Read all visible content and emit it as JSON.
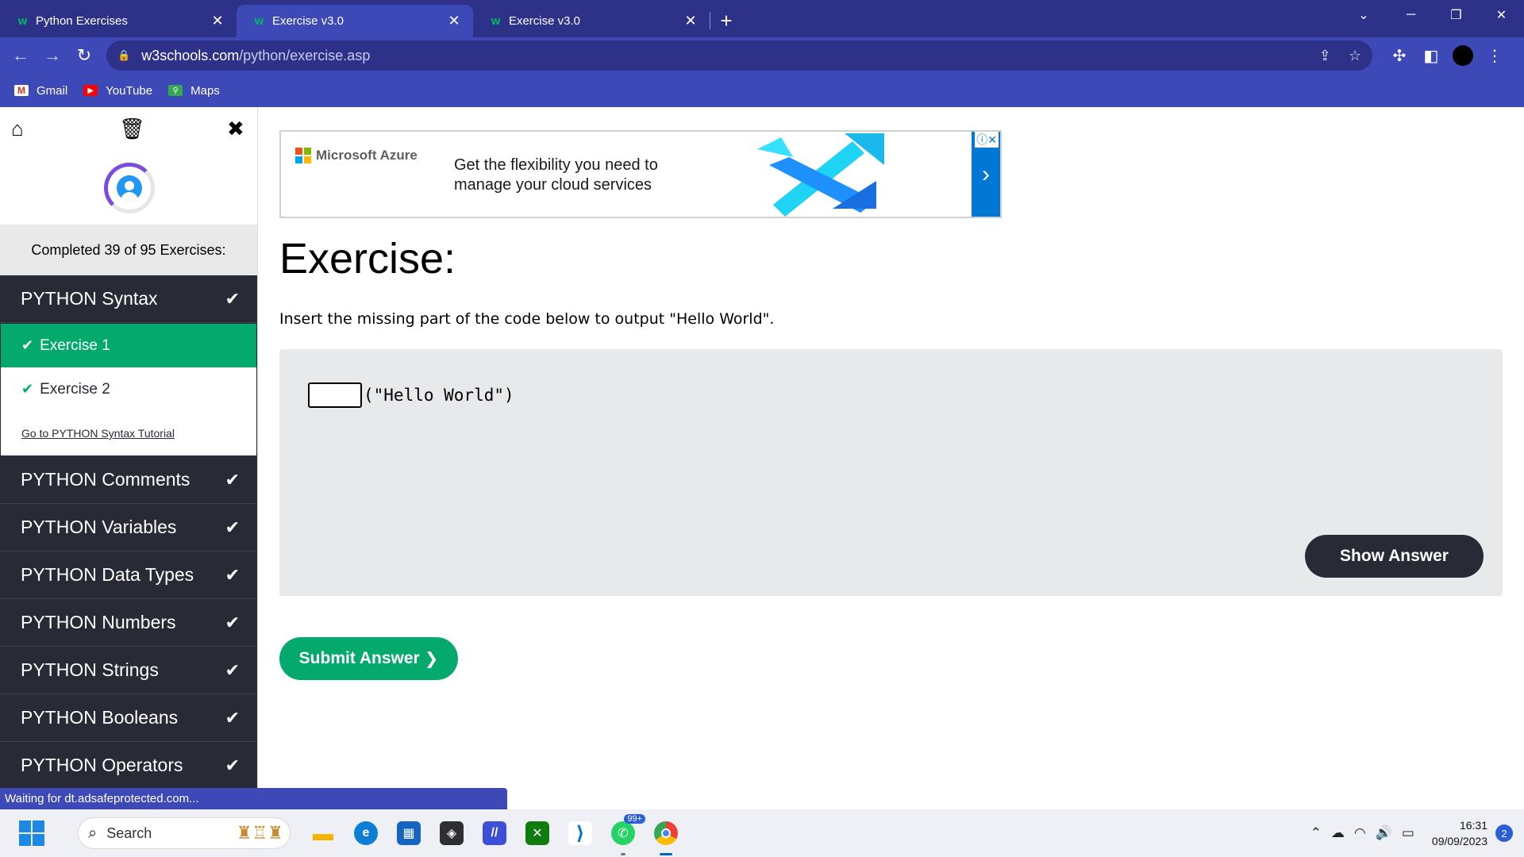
{
  "browser": {
    "tabs": [
      {
        "title": "Python Exercises",
        "favicon": "w3schools-icon",
        "active": false
      },
      {
        "title": "Exercise v3.0",
        "favicon": "w3schools-icon",
        "active": true
      },
      {
        "title": "Exercise v3.0",
        "favicon": "w3schools-icon",
        "active": false
      }
    ],
    "new_tab": "+",
    "address": {
      "domain": "w3schools.com",
      "path": "/python/exercise.asp"
    },
    "bookmarks": [
      {
        "label": "Gmail",
        "icon": "gmail-icon"
      },
      {
        "label": "YouTube",
        "icon": "youtube-icon"
      },
      {
        "label": "Maps",
        "icon": "maps-icon"
      }
    ],
    "status_text": "Waiting for dt.adsafeprotected.com..."
  },
  "sidebar": {
    "progress_text": "Completed 39 of 95 Exercises:",
    "expanded_section": {
      "label": "PYTHON Syntax",
      "exercises": [
        {
          "label": "Exercise 1",
          "active": true,
          "completed": true
        },
        {
          "label": "Exercise 2",
          "active": false,
          "completed": true
        }
      ],
      "tutorial_link": "Go to PYTHON Syntax Tutorial"
    },
    "sections": [
      {
        "label": "PYTHON Comments",
        "completed": true
      },
      {
        "label": "PYTHON Variables",
        "completed": true
      },
      {
        "label": "PYTHON Data Types",
        "completed": true
      },
      {
        "label": "PYTHON Numbers",
        "completed": true
      },
      {
        "label": "PYTHON Strings",
        "completed": true
      },
      {
        "label": "PYTHON Booleans",
        "completed": true
      },
      {
        "label": "PYTHON Operators",
        "completed": true
      }
    ]
  },
  "ad": {
    "brand": "Microsoft Azure",
    "copy_line1": "Get the flexibility you need to",
    "copy_line2": "manage your cloud services"
  },
  "exercise": {
    "title": "Exercise:",
    "instruction": "Insert the missing part of the code below to output \"Hello World\".",
    "code_suffix": "(\"Hello World\")",
    "input_value": "",
    "show_answer_label": "Show Answer",
    "submit_label": "Submit Answer"
  },
  "taskbar": {
    "search_placeholder": "Search",
    "whatsapp_badge": "99+",
    "time": "16:31",
    "date": "09/09/2023",
    "notification_count": "2"
  },
  "colors": {
    "w3_green": "#04aa6d",
    "w3_dark": "#282a35",
    "chrome_theme": "#3e49b8",
    "tabstrip": "#2d3187"
  }
}
